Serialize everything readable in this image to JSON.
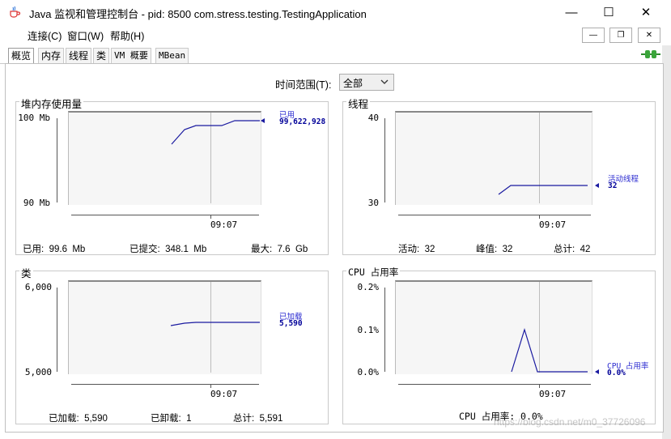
{
  "window": {
    "title": "Java 监视和管理控制台 - pid: 8500 com.stress.testing.TestingApplication",
    "minimize": "—",
    "maximize": "☐",
    "close": "✕"
  },
  "menu": {
    "items": [
      "连接(C)",
      "窗口(W)",
      "帮助(H)"
    ],
    "mdi": [
      "—",
      "❐",
      "✕"
    ]
  },
  "tabs": [
    "概览",
    "内存",
    "线程",
    "类",
    "VM 概要",
    "MBean"
  ],
  "time_range": {
    "label": "时间范围(T):",
    "value": "全部"
  },
  "panels": {
    "heap": {
      "title": "堆内存使用量",
      "y_ticks": [
        "100 Mb",
        "90 Mb"
      ],
      "x_tick": "09:07",
      "legend_name": "已用",
      "legend_value": "99,622,928",
      "stats": [
        "已用:  99.6  Mb",
        "已提交:  348.1  Mb",
        "最大:  7.6  Gb"
      ]
    },
    "threads": {
      "title": "线程",
      "y_ticks": [
        "40",
        "30"
      ],
      "x_tick": "09:07",
      "legend_name": "活动线程",
      "legend_value": "32",
      "stats": [
        "活动:  32",
        "峰值:  32",
        "总计:  42"
      ]
    },
    "classes": {
      "title": "类",
      "y_ticks": [
        "6,000",
        "5,000"
      ],
      "x_tick": "09:07",
      "legend_name": "已加载",
      "legend_value": "5,590",
      "stats": [
        "已加载:  5,590",
        "已卸载:  1",
        "总计:  5,591"
      ]
    },
    "cpu": {
      "title": "CPU 占用率",
      "y_ticks": [
        "0.2%",
        "0.1%",
        "0.0%"
      ],
      "x_tick": "09:07",
      "legend_name": "CPU 占用率",
      "legend_value": "0.0%",
      "stats": [
        "CPU 占用率: 0.0%"
      ]
    }
  },
  "watermark": "https://blog.csdn.net/m0_37726096",
  "colors": {
    "series": "#1a1aa0",
    "legend": "#2a2ad0",
    "connect_icon": "#3aa53a"
  },
  "icons": {
    "app": "java-cup-icon",
    "connect": "connection-plug-icon"
  }
}
